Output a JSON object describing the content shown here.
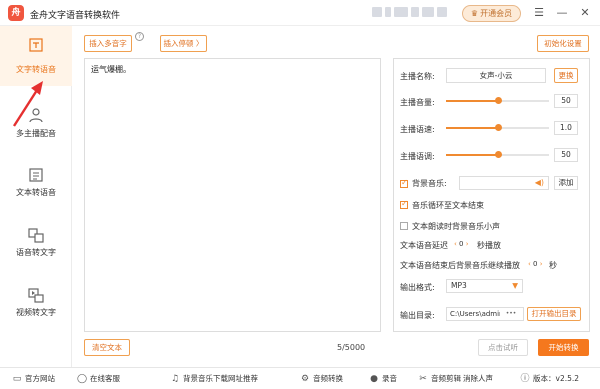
{
  "app": {
    "logo_text": "舟",
    "title": "金舟文字语音转换软件",
    "vip_label": "开通会员"
  },
  "window_controls": {
    "menu": "☰",
    "minimize": "—",
    "close": "✕"
  },
  "sidebar": {
    "items": [
      {
        "label": "文字转语音"
      },
      {
        "label": "多主播配音"
      },
      {
        "label": "文本转语音"
      },
      {
        "label": "语音转文字"
      },
      {
        "label": "视频转文字"
      }
    ]
  },
  "toolbar": {
    "insert_polyphone": "插入多音字",
    "insert_pause": "插入停顿 〉",
    "reset_settings": "初始化设置"
  },
  "editor": {
    "text": "运气爆棚。",
    "char_count": "5/5000",
    "clear_label": "清空文本"
  },
  "settings": {
    "anchor_label": "主播名称:",
    "anchor_value": "女声-小云",
    "change_label": "更换",
    "volume_label": "主播音量:",
    "volume_value": "50",
    "volume_fraction": 0.5,
    "speed_label": "主播语速:",
    "speed_value": "1.0",
    "speed_fraction": 0.5,
    "pitch_label": "主播语调:",
    "pitch_value": "50",
    "pitch_fraction": 0.5,
    "bgm_label": "背景音乐:",
    "add_label": "添加",
    "loop_label": "音乐循环至文本结束",
    "quiet_label": "文本朗读时背景音乐小声",
    "delay_label": "文本语音延迟",
    "delay_value": "0",
    "delay_unit": "秒播放",
    "after_label": "文本语音结束后背景音乐继续播放",
    "after_value": "0",
    "after_unit": "秒",
    "format_label": "输出格式:",
    "format_value": "MP3",
    "dir_label": "输出目录:",
    "dir_value": "C:\\Users\\admir",
    "dir_more": "•••",
    "open_dir_label": "打开输出目录"
  },
  "actions": {
    "preview": "点击试听",
    "start": "开始转换"
  },
  "footer": {
    "website": "官方网站",
    "support": "在线客服",
    "bgm_site": "背景音乐下载网址推荐",
    "audio_convert": "音频转换",
    "record": "录音",
    "audio_cut": "音频剪辑",
    "vocal_remove": "消除人声",
    "version": "版本：v2.5.2"
  },
  "colors": {
    "accent": "#f08a30",
    "start_button": "#f5781e",
    "arrow": "#e53030"
  }
}
